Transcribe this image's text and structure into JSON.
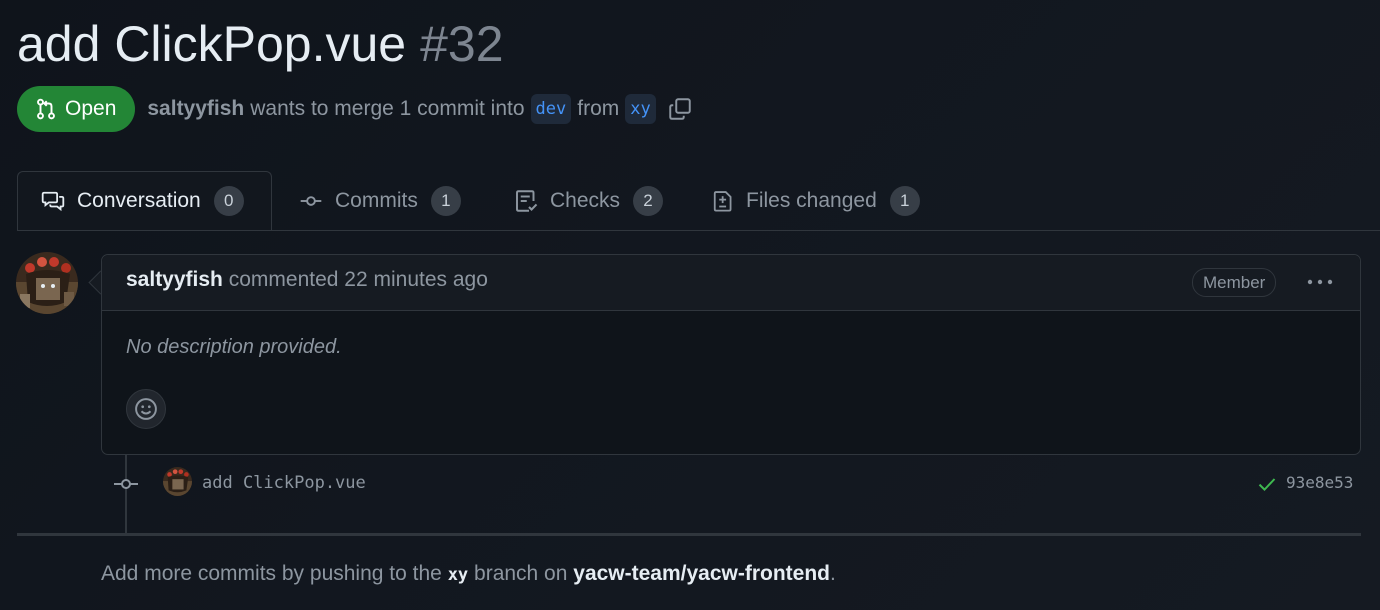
{
  "pr": {
    "title": "add ClickPop.vue",
    "number": "#32",
    "state": "Open",
    "author": "saltyyfish",
    "merge_text": "wants to merge 1 commit into",
    "base_branch": "dev",
    "from_text": "from",
    "head_branch": "xy"
  },
  "tabs": [
    {
      "label": "Conversation",
      "count": "0",
      "icon": "comment-discussion-icon",
      "active": true
    },
    {
      "label": "Commits",
      "count": "1",
      "icon": "git-commit-icon",
      "active": false
    },
    {
      "label": "Checks",
      "count": "2",
      "icon": "checklist-icon",
      "active": false
    },
    {
      "label": "Files changed",
      "count": "1",
      "icon": "file-diff-icon",
      "active": false
    }
  ],
  "comment": {
    "author": "saltyyfish",
    "action": "commented 22 minutes ago",
    "role": "Member",
    "body": "No description provided."
  },
  "commit": {
    "message": "add ClickPop.vue",
    "sha": "93e8e53",
    "status": "check-icon"
  },
  "footer": {
    "prefix": "Add more commits by pushing to the",
    "branch": "xy",
    "middle": "branch on",
    "repo": "yacw-team/yacw-frontend",
    "suffix": "."
  },
  "colors": {
    "open_green": "#238636",
    "link_blue": "#4493f8",
    "success_green": "#3fb950"
  }
}
